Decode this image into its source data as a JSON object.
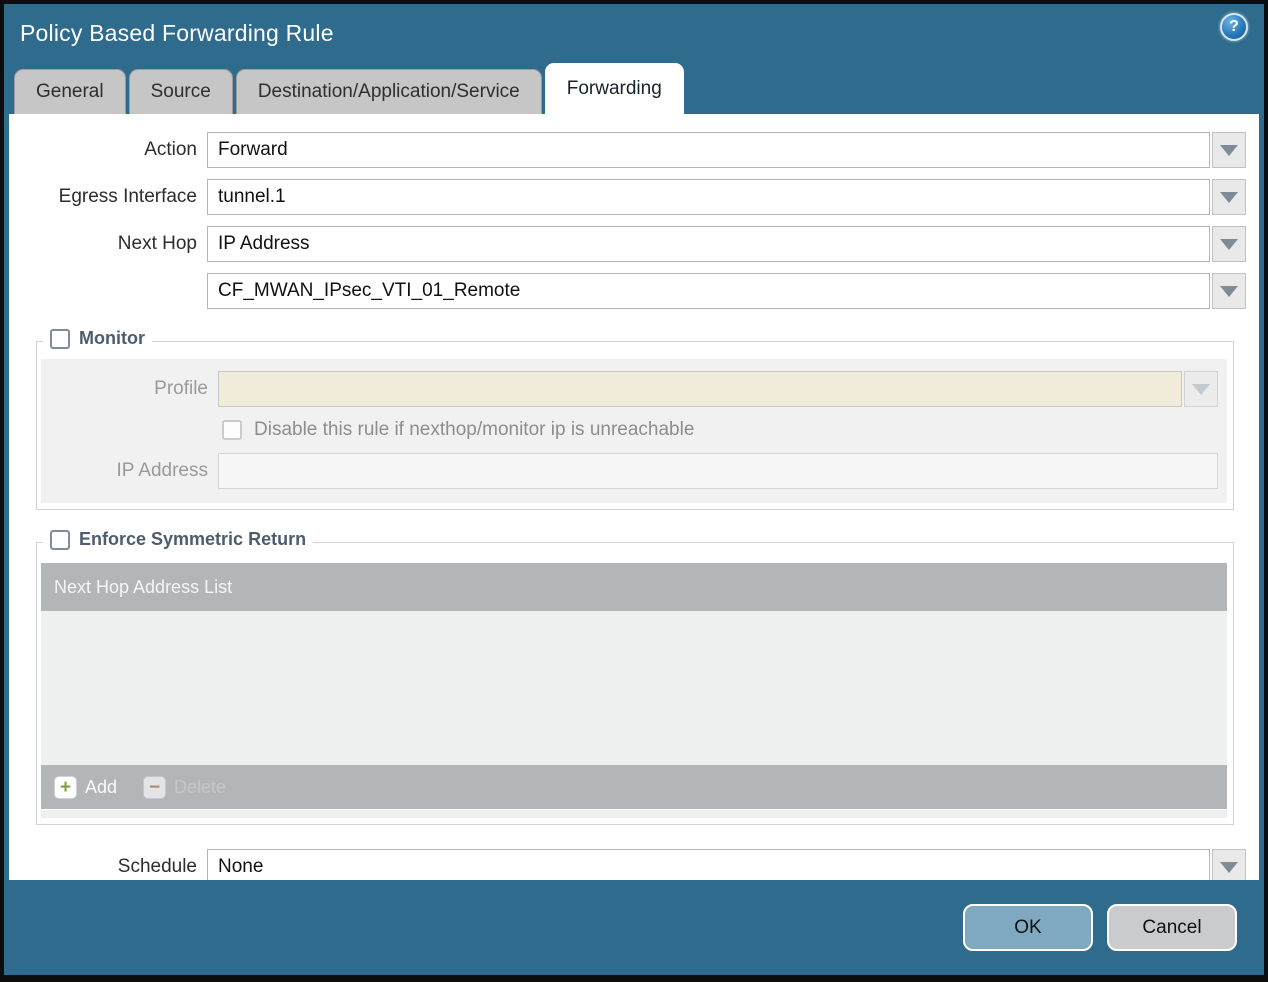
{
  "dialog": {
    "title": "Policy Based Forwarding Rule"
  },
  "icons": {
    "help_glyph": "?",
    "add_glyph": "+",
    "delete_glyph": "−"
  },
  "tabs": [
    {
      "label": "General",
      "active": false
    },
    {
      "label": "Source",
      "active": false
    },
    {
      "label": "Destination/Application/Service",
      "active": false
    },
    {
      "label": "Forwarding",
      "active": true
    }
  ],
  "form": {
    "action": {
      "label": "Action",
      "value": "Forward"
    },
    "egress_interface": {
      "label": "Egress Interface",
      "value": "tunnel.1"
    },
    "next_hop": {
      "label": "Next Hop",
      "value": "IP Address"
    },
    "next_hop_address": {
      "value": "CF_MWAN_IPsec_VTI_01_Remote"
    },
    "schedule": {
      "label": "Schedule",
      "value": "None"
    }
  },
  "monitor": {
    "legend": "Monitor",
    "checked": false,
    "profile": {
      "label": "Profile",
      "value": ""
    },
    "disable_rule_checkbox": {
      "label": "Disable this rule if nexthop/monitor ip is unreachable",
      "checked": false
    },
    "ip_address": {
      "label": "IP Address",
      "value": ""
    }
  },
  "symmetric_return": {
    "legend": "Enforce Symmetric Return",
    "checked": false,
    "table_header": "Next Hop Address List",
    "rows": [],
    "add_label": "Add",
    "delete_label": "Delete"
  },
  "footer": {
    "ok_label": "OK",
    "cancel_label": "Cancel"
  },
  "colors": {
    "frame-teal": "#2e6b8c",
    "tab-gray": "#c6c6c6",
    "active-tab-bg": "#ffffff",
    "legend-text": "#4d5d6d",
    "disabled-field-beige": "#f1ebd9",
    "panel-gray": "#f1f1f1",
    "table-bar-gray": "#b2b6b9",
    "table-body-gray": "#eff1f1",
    "add-icon-green": "#7fa33b",
    "delete-icon-red": "#b5713f",
    "ok-button-blue": "#7ea9c1",
    "cancel-button-gray": "#c9cbcd",
    "help-icon-blue": "#2476b8"
  }
}
